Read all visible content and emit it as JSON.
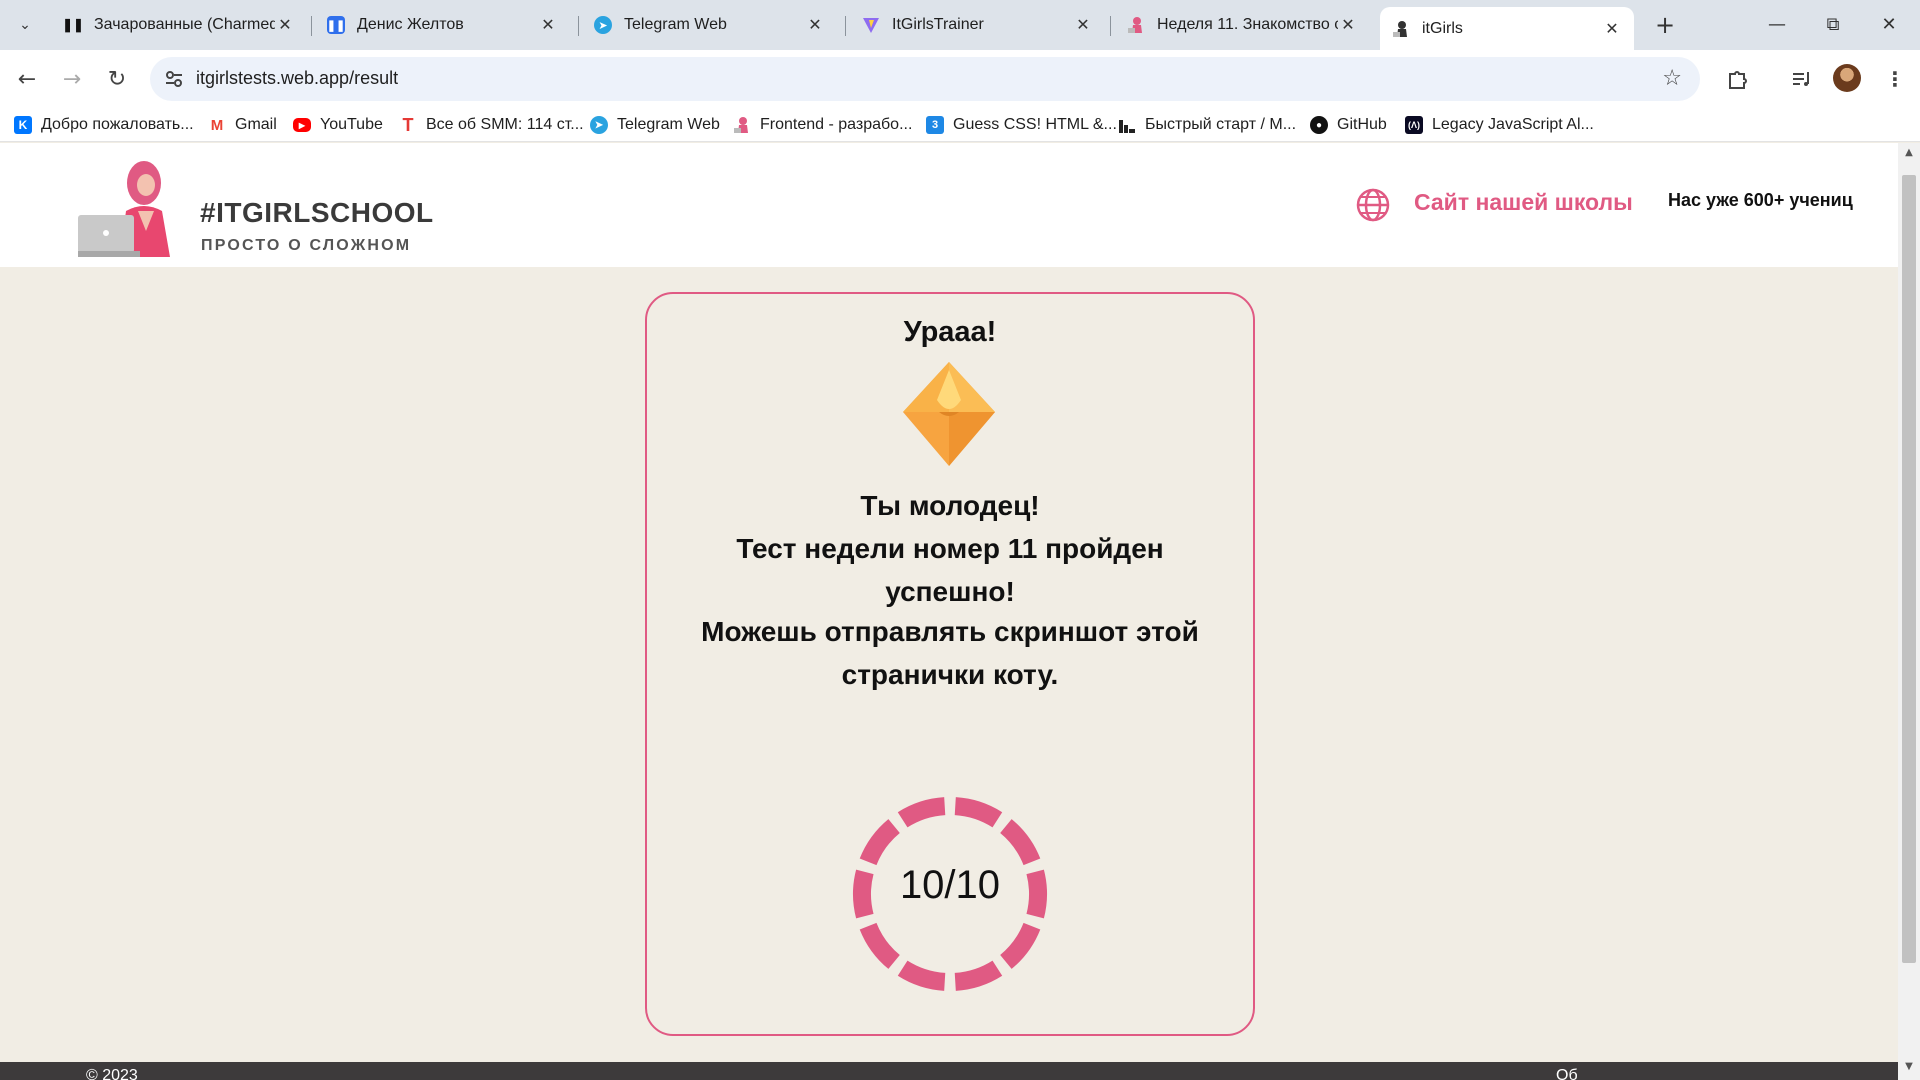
{
  "browser": {
    "tabs": [
      {
        "title": "Зачарованные (Charmed(",
        "favicon": "pause-icon",
        "active": false
      },
      {
        "title": "Денис Желтов",
        "favicon": "app-icon",
        "active": false
      },
      {
        "title": "Telegram Web",
        "favicon": "telegram-icon",
        "active": false
      },
      {
        "title": "ItGirlsTrainer",
        "favicon": "vite-icon",
        "active": false
      },
      {
        "title": "Неделя 11. Знакомство с",
        "favicon": "itgirls-icon",
        "active": false
      },
      {
        "title": "itGirls",
        "favicon": "itgirls-icon",
        "active": true
      }
    ],
    "address": {
      "url": "itgirlstests.web.app/result"
    },
    "bookmarks": [
      {
        "label": "Добро пожаловать...",
        "icon": "vk-icon",
        "color": "#0077ff"
      },
      {
        "label": "Gmail",
        "icon": "gmail-icon",
        "color": "#ea4335"
      },
      {
        "label": "YouTube",
        "icon": "youtube-icon",
        "color": "#ff0000"
      },
      {
        "label": "Все об SMM: 114 ст...",
        "icon": "t-icon",
        "color": "#e53935"
      },
      {
        "label": "Telegram Web",
        "icon": "telegram-icon",
        "color": "#2aa3e0"
      },
      {
        "label": "Frontend - разрабо...",
        "icon": "itgirls-icon",
        "color": "#e05a83"
      },
      {
        "label": "Guess CSS! HTML &...",
        "icon": "css-icon",
        "color": "#1e88e5"
      },
      {
        "label": "Быстрый старт / М...",
        "icon": "chart-icon",
        "color": "#333333"
      },
      {
        "label": "GitHub",
        "icon": "github-icon",
        "color": "#111111"
      },
      {
        "label": "Legacy JavaScript Al...",
        "icon": "fcc-icon",
        "color": "#0a0a23"
      }
    ]
  },
  "site": {
    "logo_title": "#ITGIRLSCHOOL",
    "logo_subtitle": "ПРОСТО О СЛОЖНОМ",
    "school_link": "Сайт нашей школы",
    "students": "Нас уже 600+ учениц",
    "accent": "#e05a83"
  },
  "result": {
    "title": "Урааа!",
    "line1": "Ты молодец!",
    "line2": "Тест недели номер 11 пройден успешно!",
    "line3": "Можешь отправлять скриншот этой странички коту.",
    "score": "10/10",
    "correct": 10,
    "total": 10
  },
  "footer": {
    "copy": "© 2023",
    "right": "Об"
  }
}
